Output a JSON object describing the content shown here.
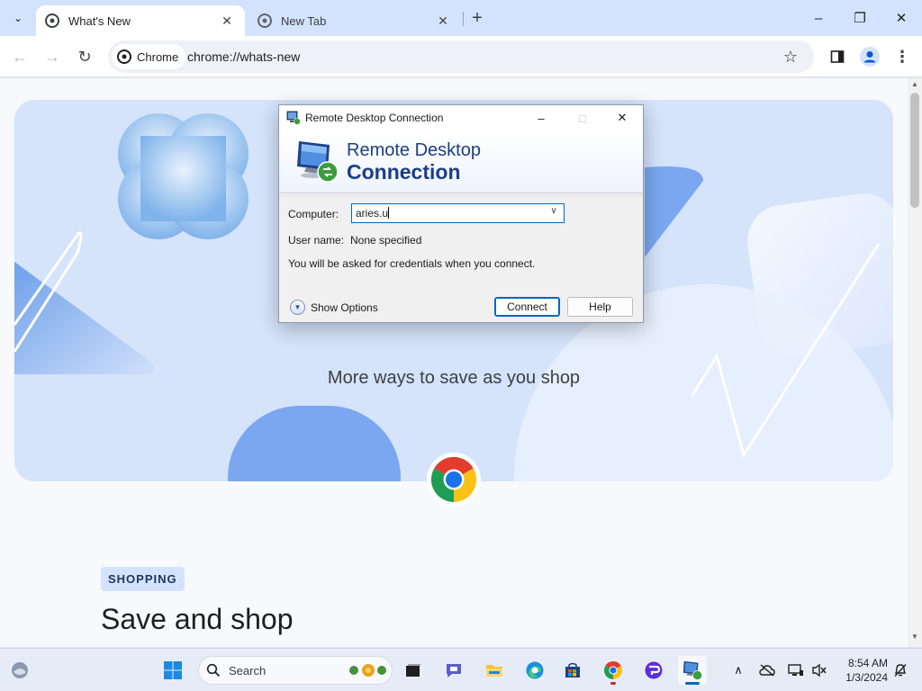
{
  "browser": {
    "tabs": [
      {
        "title": "What's New",
        "active": true
      },
      {
        "title": "New Tab",
        "active": false
      }
    ],
    "chip_label": "Chrome",
    "url": "chrome://whats-new"
  },
  "page": {
    "hero_caption": "More ways to save as you shop",
    "badge": "SHOPPING",
    "section_title": "Save and shop"
  },
  "dialog": {
    "window_title": "Remote Desktop Connection",
    "banner_line1": "Remote Desktop",
    "banner_line2": "Connection",
    "computer_label": "Computer:",
    "computer_value": "aries.u",
    "username_label": "User name:",
    "username_value": "None specified",
    "info_text": "You will be asked for credentials when you connect.",
    "show_options_label": "Show Options",
    "connect_label": "Connect",
    "help_label": "Help"
  },
  "taskbar": {
    "search_placeholder": "Search",
    "time": "8:54 AM",
    "date": "1/3/2024"
  },
  "colors": {
    "tabstrip": "#d3e3fd",
    "hero": "#d5e3fb",
    "accent": "#0067c0",
    "banner_text": "#1b3f86"
  }
}
